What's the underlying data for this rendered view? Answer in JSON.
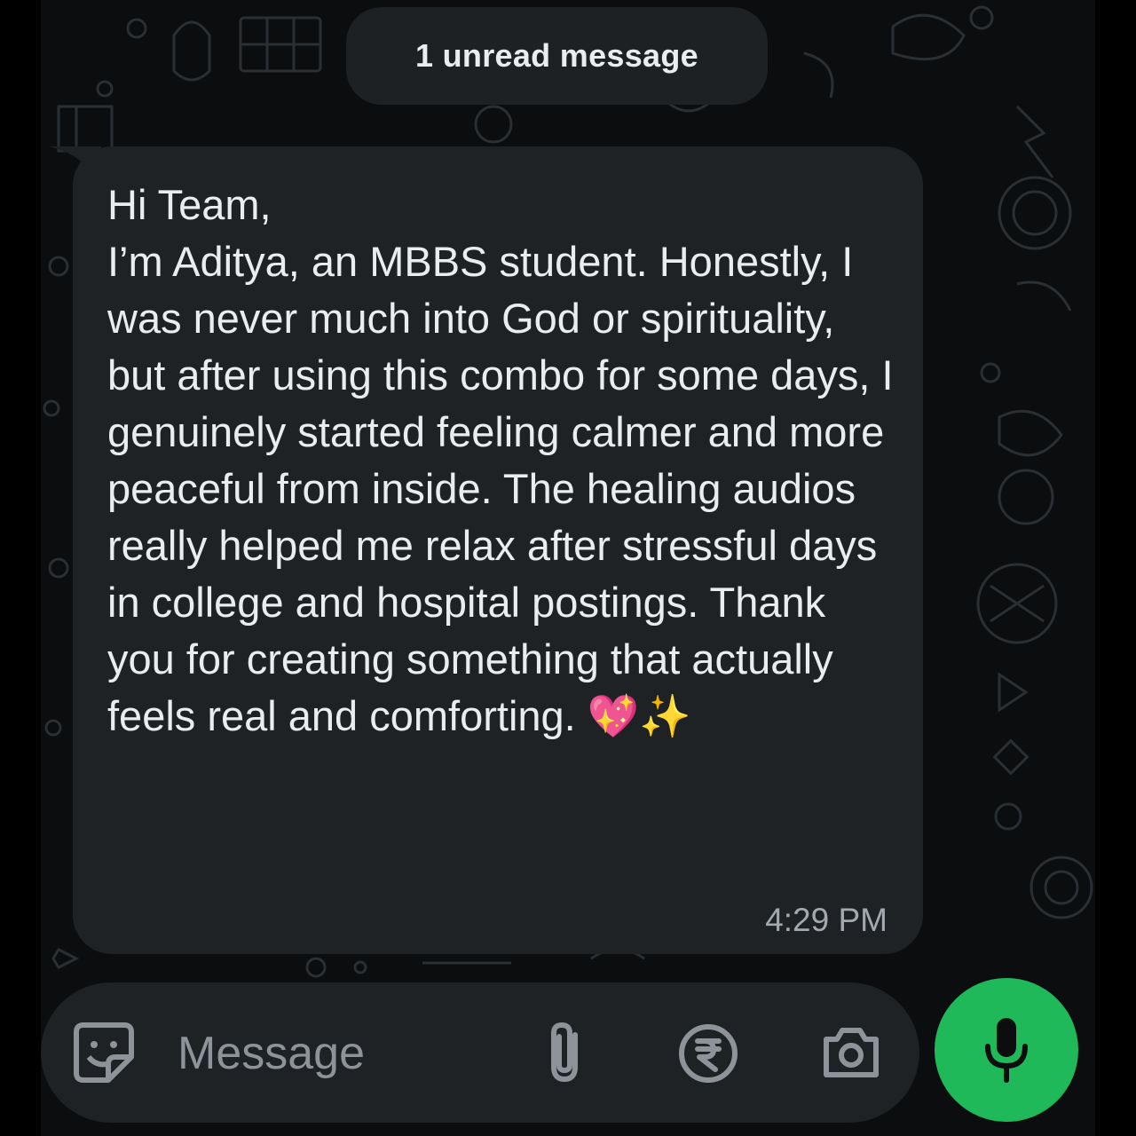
{
  "banner": {
    "unread_label": "1 unread message"
  },
  "message": {
    "text": "Hi Team,\nI’m Aditya, an MBBS student. Honestly, I was never much into God or spirituality, but after using this combo for some days, I genuinely started feeling calmer and more peaceful from inside. The healing audios really helped me relax after stressful days in college and hospital postings. Thank you for creating something that actually feels real and comforting. 💖✨",
    "time": "4:29 PM",
    "direction": "incoming"
  },
  "composer": {
    "placeholder": "Message",
    "icons": [
      "sticker-icon",
      "attach-icon",
      "rupee-payment-icon",
      "camera-icon",
      "mic-icon"
    ]
  },
  "colors": {
    "chat_background": "#0b0d0e",
    "bubble": "#1f2224",
    "message_text": "#e9edef",
    "timestamp": "#a3a9ae",
    "composer_icons": "#8d9398",
    "mic_button": "#1fb95a"
  }
}
